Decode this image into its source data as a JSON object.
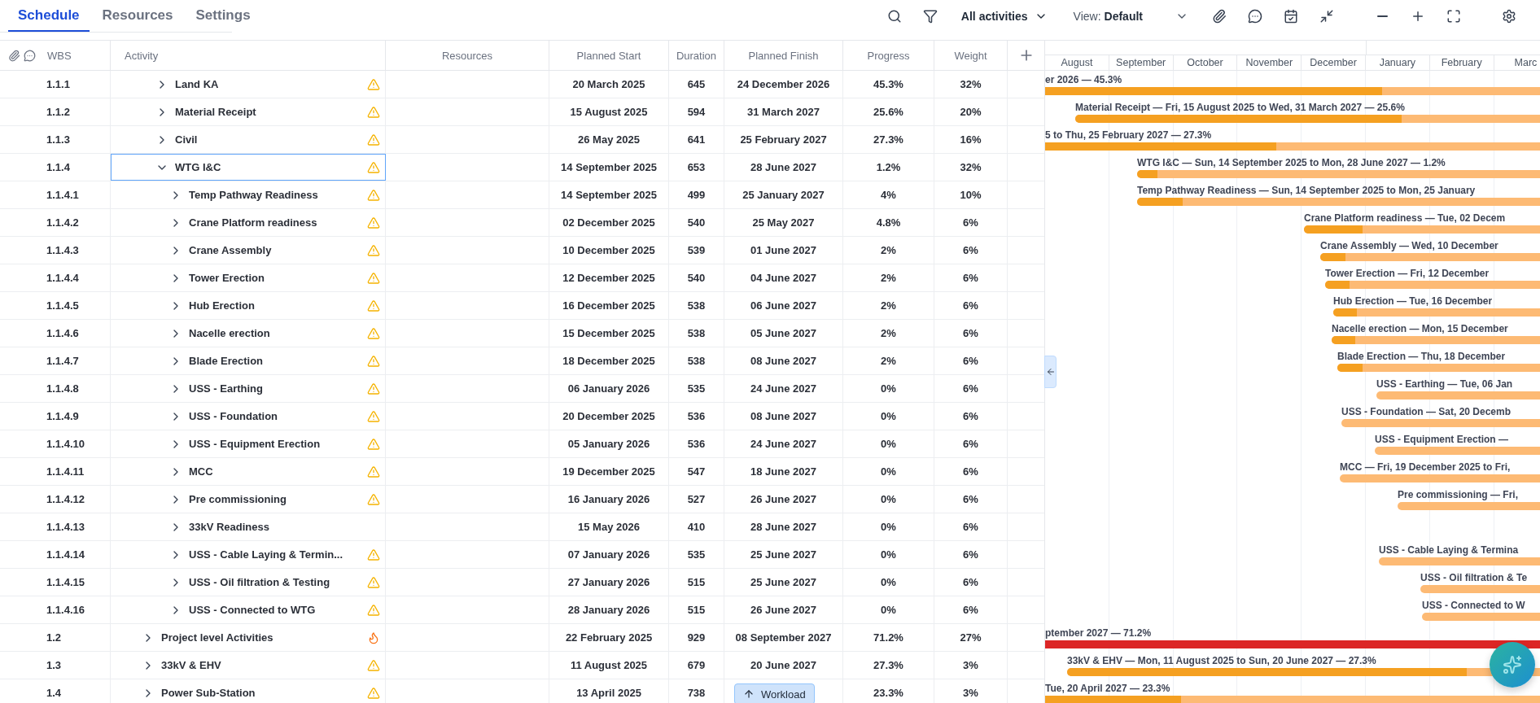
{
  "tabs": [
    {
      "label": "Schedule",
      "selected": true
    },
    {
      "label": "Resources",
      "selected": false
    },
    {
      "label": "Settings",
      "selected": false
    }
  ],
  "toolbar": {
    "filter": "All activities",
    "view_prefix": "View:",
    "view_value": "Default"
  },
  "columns": [
    "WBS",
    "Activity",
    "Resources",
    "Planned Start",
    "Duration",
    "Planned Finish",
    "Progress",
    "Weight"
  ],
  "gantt": {
    "months": [
      {
        "label": "August",
        "year_start": false
      },
      {
        "label": "September",
        "year_start": false
      },
      {
        "label": "October",
        "year_start": false
      },
      {
        "label": "November",
        "year_start": false
      },
      {
        "label": "December",
        "year_start": false
      },
      {
        "label": "January",
        "year_start": true
      },
      {
        "label": "February",
        "year_start": false
      },
      {
        "label": "Marc",
        "year_start": false
      }
    ]
  },
  "rows": [
    {
      "wbs": "1.1.1",
      "activity": "Land KA",
      "kind": "warning",
      "expanded": false,
      "selected": false,
      "start": "20 March 2025",
      "duration": "645",
      "finish": "24 December 2026",
      "progress": "45.3%",
      "weight": "32%",
      "bar": {
        "label": "er 2026 — 45.3%",
        "level": 0.67,
        "color": "#fdba74"
      }
    },
    {
      "wbs": "1.1.2",
      "activity": "Material Receipt",
      "kind": "warning",
      "expanded": false,
      "selected": false,
      "start": "15 August 2025",
      "duration": "594",
      "finish": "31 March 2027",
      "progress": "25.6%",
      "weight": "20%",
      "bar": {
        "label": "Material Receipt — Fri, 15 August 2025 to Wed, 31 March 2027 — 25.6%",
        "level": 0.69,
        "color": "#fdba74"
      }
    },
    {
      "wbs": "1.1.3",
      "activity": "Civil",
      "kind": "warning",
      "expanded": false,
      "selected": false,
      "start": "26 May 2025",
      "duration": "641",
      "finish": "25 February 2027",
      "progress": "27.3%",
      "weight": "16%",
      "bar": {
        "label": "5 to Thu, 25 February 2027 — 27.3%",
        "level": 0.46,
        "color": "#fdba74"
      }
    },
    {
      "wbs": "1.1.4",
      "activity": "WTG I&C",
      "kind": "warning",
      "expanded": true,
      "selected": true,
      "start": "14 September 2025",
      "duration": "653",
      "finish": "28 June 2027",
      "progress": "1.2%",
      "weight": "32%",
      "bar": {
        "label": "WTG I&C — Sun, 14 September 2025 to Mon, 28 June 2027 — 1.2%",
        "level": 0.05,
        "color": "#fdba74"
      },
      "children": [
        {
          "wbs": "1.1.4.1",
          "activity": "Temp Pathway Readiness",
          "kind": "warning",
          "expanded": false,
          "selected": false,
          "start": "14 September 2025",
          "duration": "499",
          "finish": "25 January 2027",
          "progress": "4%",
          "weight": "10%",
          "bar": {
            "label": "Temp Pathway Readiness — Sun, 14 September 2025 to Mon, 25 January",
            "level": 0.11,
            "color": "#fdba74"
          }
        },
        {
          "wbs": "1.1.4.2",
          "activity": "Crane Platform readiness",
          "kind": "warning",
          "expanded": false,
          "selected": false,
          "start": "02 December 2025",
          "duration": "540",
          "finish": "25 May 2027",
          "progress": "4.8%",
          "weight": "6%",
          "bar": {
            "label": "Crane Platform readiness — Tue, 02 Decem",
            "level": 0.24,
            "color": "#fdba74"
          }
        },
        {
          "wbs": "1.1.4.3",
          "activity": "Crane Assembly",
          "kind": "warning",
          "expanded": false,
          "selected": false,
          "start": "10 December 2025",
          "duration": "539",
          "finish": "01 June 2027",
          "progress": "2%",
          "weight": "6%",
          "bar": {
            "label": "Crane Assembly — Wed, 10 December",
            "level": 0.11,
            "color": "#fdba74"
          }
        },
        {
          "wbs": "1.1.4.4",
          "activity": "Tower Erection",
          "kind": "warning",
          "expanded": false,
          "selected": false,
          "start": "12 December 2025",
          "duration": "540",
          "finish": "04 June 2027",
          "progress": "2%",
          "weight": "6%",
          "bar": {
            "label": "Tower Erection — Fri, 12 December",
            "level": 0.11,
            "color": "#fdba74"
          }
        },
        {
          "wbs": "1.1.4.5",
          "activity": "Hub Erection",
          "kind": "warning",
          "expanded": false,
          "selected": false,
          "start": "16 December 2025",
          "duration": "538",
          "finish": "06 June 2027",
          "progress": "2%",
          "weight": "6%",
          "bar": {
            "label": "Hub Erection — Tue, 16 December",
            "level": 0.11,
            "color": "#fdba74"
          }
        },
        {
          "wbs": "1.1.4.6",
          "activity": "Nacelle erection",
          "kind": "warning",
          "expanded": false,
          "selected": false,
          "start": "15 December 2025",
          "duration": "538",
          "finish": "05 June 2027",
          "progress": "2%",
          "weight": "6%",
          "bar": {
            "label": "Nacelle erection — Mon, 15 December",
            "level": 0.11,
            "color": "#fdba74"
          }
        },
        {
          "wbs": "1.1.4.7",
          "activity": "Blade Erection",
          "kind": "warning",
          "expanded": false,
          "selected": false,
          "start": "18 December 2025",
          "duration": "538",
          "finish": "08 June 2027",
          "progress": "2%",
          "weight": "6%",
          "bar": {
            "label": "Blade Erection — Thu, 18 December",
            "level": 0.12,
            "color": "#fdba74"
          }
        },
        {
          "wbs": "1.1.4.8",
          "activity": "USS - Earthing",
          "kind": "warning",
          "expanded": false,
          "selected": false,
          "start": "06 January 2026",
          "duration": "535",
          "finish": "24 June 2027",
          "progress": "0%",
          "weight": "6%",
          "bar": {
            "label": "USS - Earthing — Tue, 06 Jan",
            "level": 0,
            "color": "#fdba74"
          }
        },
        {
          "wbs": "1.1.4.9",
          "activity": "USS - Foundation",
          "kind": "warning",
          "expanded": false,
          "selected": false,
          "start": "20 December 2025",
          "duration": "536",
          "finish": "08 June 2027",
          "progress": "0%",
          "weight": "6%",
          "bar": {
            "label": "USS - Foundation — Sat, 20 Decemb",
            "level": 0,
            "color": "#fdba74"
          }
        },
        {
          "wbs": "1.1.4.10",
          "activity": "USS - Equipment Erection",
          "kind": "warning",
          "expanded": false,
          "selected": false,
          "start": "05 January 2026",
          "duration": "536",
          "finish": "24 June 2027",
          "progress": "0%",
          "weight": "6%",
          "bar": {
            "label": "USS - Equipment Erection —",
            "level": 0,
            "color": "#fdba74"
          }
        },
        {
          "wbs": "1.1.4.11",
          "activity": "MCC",
          "kind": "warning",
          "expanded": false,
          "selected": false,
          "start": "19 December 2025",
          "duration": "547",
          "finish": "18 June 2027",
          "progress": "0%",
          "weight": "6%",
          "bar": {
            "label": "MCC — Fri, 19 December 2025 to Fri,",
            "level": 0,
            "color": "#fdba74"
          }
        },
        {
          "wbs": "1.1.4.12",
          "activity": "Pre commissioning",
          "kind": "warning",
          "expanded": false,
          "selected": false,
          "start": "16 January 2026",
          "duration": "527",
          "finish": "26 June 2027",
          "progress": "0%",
          "weight": "6%",
          "bar": {
            "label": "Pre commissioning — Fri,",
            "level": 0,
            "color": "#fdba74"
          }
        },
        {
          "wbs": "1.1.4.13",
          "activity": "33kV Readiness",
          "expanded": false,
          "selected": false,
          "start": "15 May 2026",
          "duration": "410",
          "finish": "28 June 2027",
          "progress": "0%",
          "weight": "6%"
        },
        {
          "wbs": "1.1.4.14",
          "activity": "USS - Cable Laying & Termin...",
          "kind": "warning",
          "expanded": false,
          "selected": false,
          "start": "07 January 2026",
          "duration": "535",
          "finish": "25 June 2027",
          "progress": "0%",
          "weight": "6%",
          "bar": {
            "label": "USS - Cable Laying & Termina",
            "level": 0,
            "color": "#fdba74"
          }
        },
        {
          "wbs": "1.1.4.15",
          "activity": "USS - Oil filtration & Testing",
          "kind": "warning",
          "expanded": false,
          "selected": false,
          "start": "27 January 2026",
          "duration": "515",
          "finish": "25 June 2027",
          "progress": "0%",
          "weight": "6%",
          "bar": {
            "label": "USS - Oil filtration & Te",
            "level": 0,
            "color": "#fdba74"
          }
        },
        {
          "wbs": "1.1.4.16",
          "activity": "USS - Connected to WTG",
          "kind": "warning",
          "expanded": false,
          "selected": false,
          "start": "28 January 2026",
          "duration": "515",
          "finish": "26 June 2027",
          "progress": "0%",
          "weight": "6%",
          "bar": {
            "label": "USS - Connected to W",
            "level": 0,
            "color": "#fdba74"
          }
        }
      ]
    },
    {
      "wbs": "1.2",
      "activity": "Project level Activities",
      "kind": "fire",
      "expanded": false,
      "selected": false,
      "start": "22 February 2025",
      "duration": "929",
      "finish": "08 September 2027",
      "progress": "71.2%",
      "weight": "27%",
      "bar": {
        "label": "ptember 2027 — 71.2%",
        "level": 1,
        "color": "#dc2626"
      }
    },
    {
      "wbs": "1.3",
      "activity": "33kV & EHV",
      "kind": "warning",
      "expanded": false,
      "selected": false,
      "start": "11 August 2025",
      "duration": "679",
      "finish": "20 June 2027",
      "progress": "27.3%",
      "weight": "3%",
      "bar": {
        "label": "33kV & EHV — Mon, 11 August 2025 to Sun, 20 June 2027 — 27.3%",
        "level": 0.83,
        "color": "#fdba74"
      }
    },
    {
      "wbs": "1.4",
      "activity": "Power Sub-Station",
      "kind": "warning",
      "expanded": false,
      "selected": false,
      "start": "13 April 2025",
      "duration": "738",
      "progress": "23.3%",
      "weight": "3%",
      "bar": {
        "label": "Tue, 20 April 2027 — 23.3%",
        "level": 0.27,
        "color": "#fdba74"
      }
    }
  ],
  "workload_button": "Workload"
}
